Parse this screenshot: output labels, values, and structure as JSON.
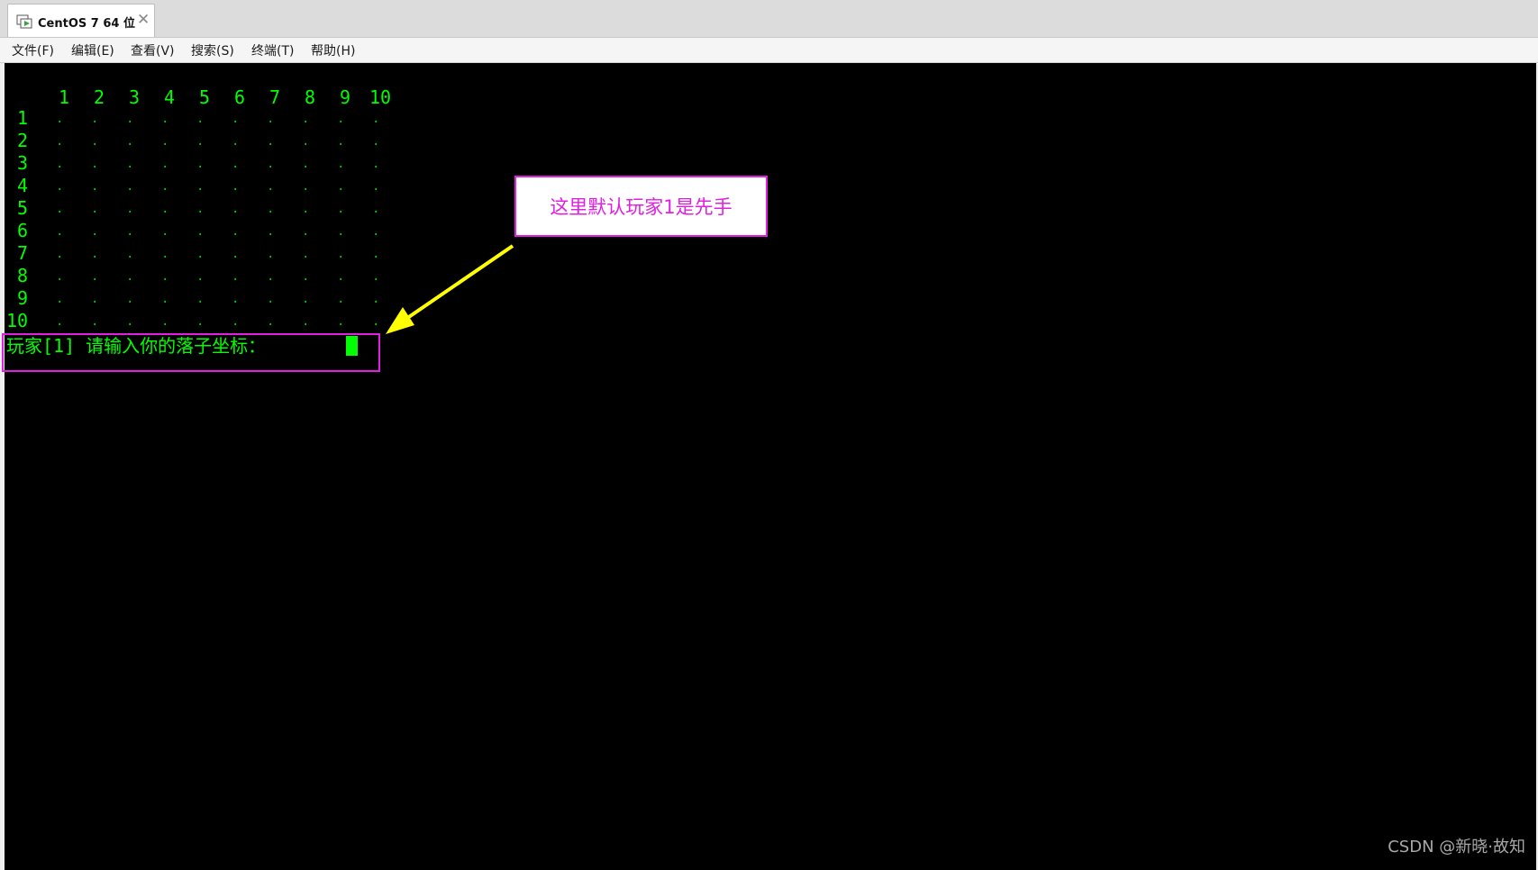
{
  "window": {
    "tab_title": "CentOS 7 64 位",
    "tab_close": "✕"
  },
  "menu": [
    "文件(F)",
    "编辑(E)",
    "查看(V)",
    "搜索(S)",
    "终端(T)",
    "帮助(H)"
  ],
  "terminal": {
    "column_headers": [
      "1",
      "2",
      "3",
      "4",
      "5",
      "6",
      "7",
      "8",
      "9",
      "10"
    ],
    "row_headers": [
      "1",
      "2",
      "3",
      "4",
      "5",
      "6",
      "7",
      "8",
      "9",
      "10"
    ],
    "empty_cell": ".",
    "prompt": "玩家[1] 请输入你的落子坐标："
  },
  "annotation": {
    "callout_text": "这里默认玩家1是先手",
    "color": "#e020e0",
    "arrow_color": "#ffff00"
  },
  "watermark": "CSDN @新晓·故知",
  "colors": {
    "terminal_bg": "#000000",
    "terminal_fg": "#00ff00"
  }
}
